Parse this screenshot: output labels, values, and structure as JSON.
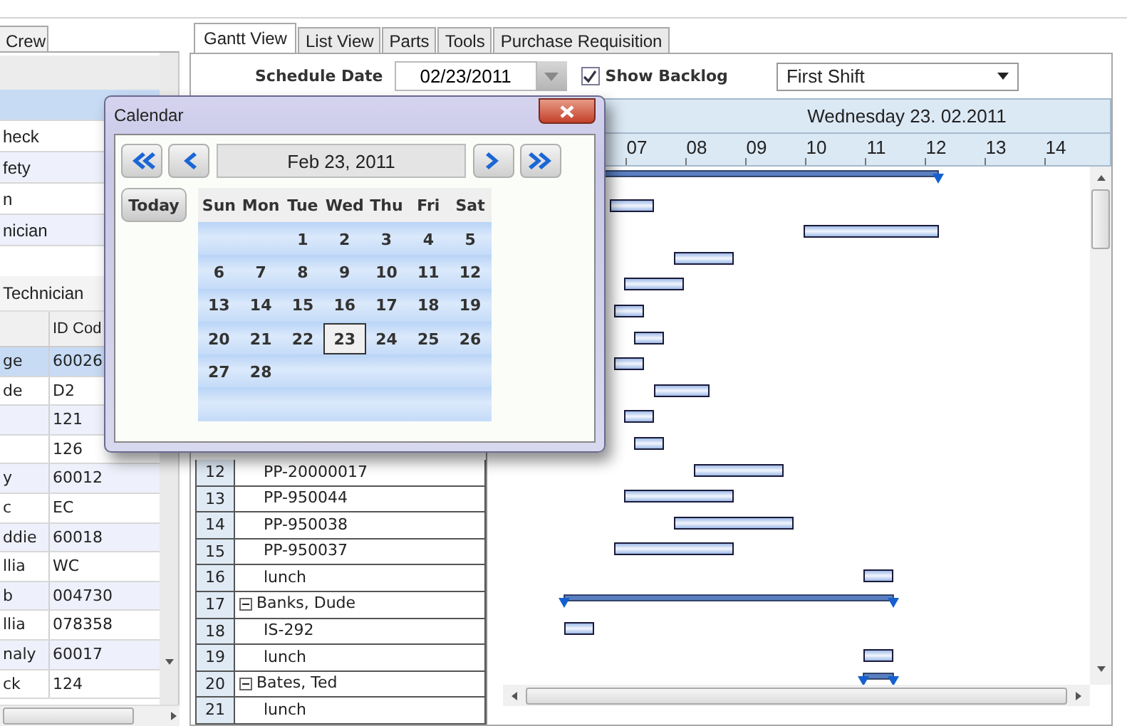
{
  "crew_panel": {
    "tab": "Crew",
    "list": [
      {
        "selected": true
      },
      {
        "label": "heck",
        "selected": false
      },
      {
        "label": "fety",
        "selected": false
      },
      {
        "label": "n",
        "selected": false
      },
      {
        "label": "nician",
        "selected": false
      }
    ],
    "group_label": "Technician",
    "table": {
      "id_header": "ID Cod",
      "rows": [
        {
          "column_1": "ge",
          "id_code": "60026",
          "selected": true
        },
        {
          "column_1": "de",
          "id_code": "D2",
          "selected": false
        },
        {
          "id_code": "121",
          "selected": false
        },
        {
          "id_code": "126",
          "selected": false
        },
        {
          "column_1": "y",
          "id_code": "60012",
          "selected": false
        },
        {
          "column_1": "c",
          "id_code": "EC",
          "selected": false
        },
        {
          "column_1": "ddie",
          "id_code": "60018",
          "selected": false
        },
        {
          "column_1": "llia",
          "id_code": "WC",
          "selected": false
        },
        {
          "column_1": "b",
          "id_code": "004730",
          "selected": false
        },
        {
          "column_1": "llia",
          "id_code": "078358",
          "selected": false
        },
        {
          "column_1": "naly",
          "id_code": "60017",
          "selected": false
        },
        {
          "column_1": "ck",
          "id_code": "124",
          "selected": false
        }
      ]
    }
  },
  "tabs": [
    {
      "label": "Gantt View",
      "selected": true
    },
    {
      "label": "List View",
      "selected": false
    },
    {
      "label": "Parts",
      "selected": false
    },
    {
      "label": "Tools",
      "selected": false
    },
    {
      "label": "Purchase Requisition",
      "selected": false
    }
  ],
  "toolbar": {
    "schedule_date_label": "Schedule Date",
    "schedule_date": "02/23/2011",
    "show_backlog": {
      "label": "Show Backlog",
      "checked": true
    },
    "shift": "First Shift"
  },
  "grid_rows": [
    {
      "number": "12",
      "kind": "task",
      "name": "PP-20000017"
    },
    {
      "number": "13",
      "kind": "task",
      "name": "PP-950044"
    },
    {
      "number": "14",
      "kind": "task",
      "name": "PP-950038"
    },
    {
      "number": "15",
      "kind": "task",
      "name": "PP-950037"
    },
    {
      "number": "16",
      "kind": "task",
      "name": "lunch"
    },
    {
      "number": "17",
      "kind": "group",
      "name": "Banks, Dude",
      "expanded": true
    },
    {
      "number": "18",
      "kind": "task",
      "name": "IS-292"
    },
    {
      "number": "19",
      "kind": "task",
      "name": "lunch"
    },
    {
      "number": "20",
      "kind": "group",
      "name": "Bates, Ted",
      "expanded": true
    },
    {
      "number": "21",
      "kind": "task",
      "name": "lunch"
    }
  ],
  "gantt": {
    "title": "Wednesday 23. 02.2011",
    "bars": [
      {
        "kind": "summary"
      },
      {
        "kind": "task"
      },
      {
        "kind": "task"
      },
      {
        "kind": "task"
      },
      {
        "kind": "task"
      },
      {
        "kind": "task"
      },
      {
        "kind": "task"
      },
      {
        "kind": "task"
      },
      {
        "kind": "task"
      },
      {
        "kind": "task"
      },
      {
        "kind": "task"
      },
      {
        "kind": "task"
      },
      {
        "kind": "task"
      },
      {
        "kind": "task"
      },
      {
        "kind": "task"
      },
      {
        "kind": "task"
      },
      {
        "kind": "summary"
      },
      {
        "kind": "task"
      },
      {
        "kind": "task"
      },
      {
        "kind": "summary"
      }
    ],
    "hours": [
      "07",
      "08",
      "09",
      "10",
      "11",
      "12",
      "13",
      "14"
    ]
  },
  "calendar": {
    "title": "Calendar",
    "month_label": "Feb 23, 2011",
    "today": "Today",
    "weekdays": [
      "Sun",
      "Mon",
      "Tue",
      "Wed",
      "Thu",
      "Fri",
      "Sat"
    ],
    "weeks": [
      {
        "days": [
          {
            "label": "1",
            "selected": false
          },
          {
            "label": "2",
            "selected": false
          },
          {
            "label": "3",
            "selected": false
          },
          {
            "label": "4",
            "selected": false
          },
          {
            "label": "5",
            "selected": false
          }
        ]
      },
      {
        "days": [
          {
            "label": "6",
            "selected": false
          },
          {
            "label": "7",
            "selected": false
          },
          {
            "label": "8",
            "selected": false
          },
          {
            "label": "9",
            "selected": false
          },
          {
            "label": "10",
            "selected": false
          },
          {
            "label": "11",
            "selected": false
          },
          {
            "label": "12",
            "selected": false
          }
        ]
      },
      {
        "days": [
          {
            "label": "13",
            "selected": false
          },
          {
            "label": "14",
            "selected": false
          },
          {
            "label": "15",
            "selected": false
          },
          {
            "label": "16",
            "selected": false
          },
          {
            "label": "17",
            "selected": false
          },
          {
            "label": "18",
            "selected": false
          },
          {
            "label": "19",
            "selected": false
          }
        ]
      },
      {
        "days": [
          {
            "label": "20",
            "selected": false
          },
          {
            "label": "21",
            "selected": false
          },
          {
            "label": "22",
            "selected": false
          },
          {
            "label": "23",
            "selected": true
          },
          {
            "label": "24",
            "selected": false
          },
          {
            "label": "25",
            "selected": false
          },
          {
            "label": "26",
            "selected": false
          }
        ]
      },
      {
        "days": [
          {
            "label": "27",
            "selected": false
          },
          {
            "label": "28",
            "selected": false
          }
        ]
      }
    ]
  }
}
